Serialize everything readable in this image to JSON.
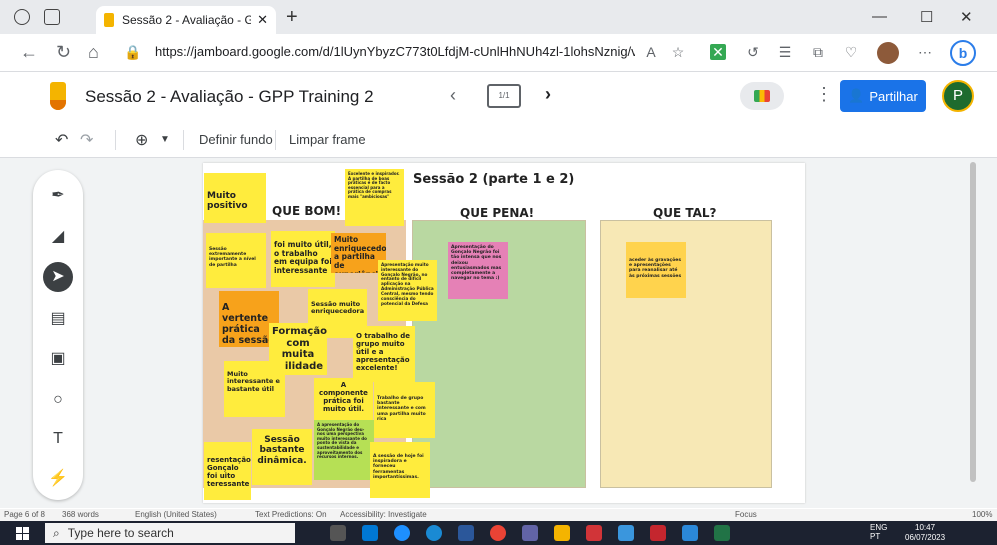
{
  "browser": {
    "tab_title": "Sessão 2 - Avaliação - GPP Trainin",
    "url": "https://jamboard.google.com/d/1lUynYbyzC773t0LfdjM-cUnlHhNUh4zl-1lohsNznig/viewer?f=0"
  },
  "app": {
    "doc_title": "Sessão 2 - Avaliação - GPP Training 2",
    "frame_indicator": "1/1",
    "share_label": "Partilhar",
    "avatar_letter": "P"
  },
  "toolbar": {
    "set_background": "Definir fundo",
    "clear_frame": "Limpar frame"
  },
  "board": {
    "title": "Sessão 2 (parte 1 e 2)",
    "col_good": "QUE BOM!",
    "col_pity": "QUE PENA!",
    "col_what_if": "QUE TAL?"
  },
  "notes": {
    "n1": "Muito positivo",
    "n2": "Excelente e inspirador. A partilha de boas práticas é de facto essencial para a prática de compras mais \"ambiciosas\"",
    "n3": "Sessão extremamente importante a nível de partilha",
    "n4": "foi muito útil, o trabalho em equipa foi interessante",
    "n5": "Muito enriquecedor a partilha de experiências",
    "n6": "Apresentação muito interessante do Gonçalo Negrão, no entanto de difícil aplicação na Administração Pública Central, mesmo tendo consciência do potencial da Defesa",
    "n7": "A vertente prática da sessão",
    "n8": "Sessão muito enriquecedora",
    "n9": "Formação com muita utilidade",
    "n10": "O trabalho de grupo muito útil e a apresentação excelente!",
    "n11": "Muito interessante e bastante útil",
    "n12": "A componente prática foi muito útil.",
    "n13": "Trabalho de grupo bastante interessante e com uma partilha muito rica",
    "n14": "Sessão bastante dinâmica.",
    "n15": "A apresentação do Gonçalo Negrão deu-nos uma perspectiva muito interessante do ponto de vista da sustentabilidade e aproveitamento dos recursos internos.",
    "n16": "A sessão de hoje foi inspiradora e forneceu ferramentas importantíssimas.",
    "n17": "resentação Gonçalo foi uito teressante",
    "n18": "Apresentação do Gonçalo Negrão foi tão intensa que nos deixou entusiasmados mas completamente a navegar no tema :)",
    "n19": "aceder às gravações e apresentações para reanalisar até às próximas sessões"
  },
  "statusbar": {
    "page": "Page 6 of 8",
    "words": "368 words",
    "language": "English (United States)",
    "predictions": "Text Predictions: On",
    "accessibility": "Accessibility: Investigate",
    "focus": "Focus",
    "zoom": "100%"
  },
  "taskbar": {
    "search_placeholder": "Type here to search",
    "lang": "ENG",
    "lang2": "PT",
    "time": "10:47",
    "date": "06/07/2023"
  },
  "colors": {
    "yellow_note": "#ffec3d",
    "orange_note": "#f7a21b",
    "pink_note": "#e581b6",
    "green_note": "#b6e055",
    "good_col": "#eac9a7",
    "pity_col": "#b9d8a1",
    "whatif_col": "#f7e8b5",
    "accent": "#1a73e8"
  }
}
